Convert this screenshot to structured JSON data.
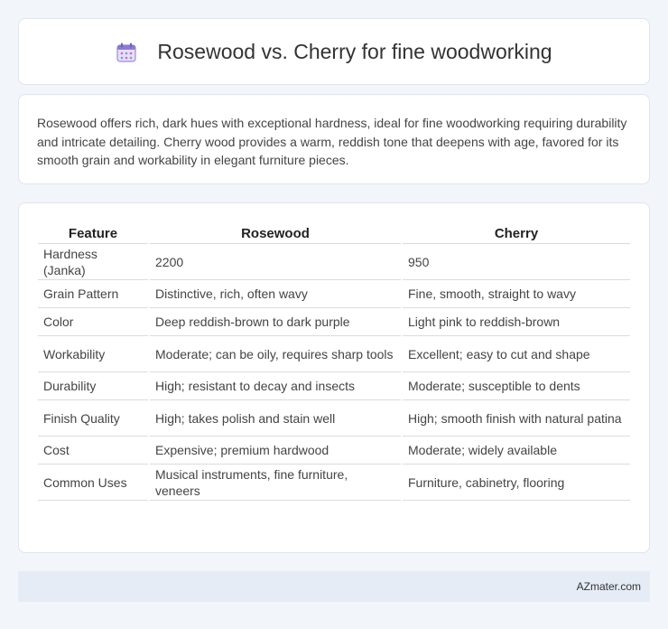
{
  "header": {
    "title": "Rosewood vs. Cherry for fine woodworking",
    "icon": "calendar-icon"
  },
  "description": "Rosewood offers rich, dark hues with exceptional hardness, ideal for fine woodworking requiring durability and intricate detailing. Cherry wood provides a warm, reddish tone that deepens with age, favored for its smooth grain and workability in elegant furniture pieces.",
  "table": {
    "columns": [
      "Feature",
      "Rosewood",
      "Cherry"
    ],
    "rows": [
      [
        "Hardness (Janka)",
        "2200",
        "950"
      ],
      [
        "Grain Pattern",
        "Distinctive, rich, often wavy",
        "Fine, smooth, straight to wavy"
      ],
      [
        "Color",
        "Deep reddish-brown to dark purple",
        "Light pink to reddish-brown"
      ],
      [
        "Workability",
        "Moderate; can be oily, requires sharp tools",
        "Excellent; easy to cut and shape"
      ],
      [
        "Durability",
        "High; resistant to decay and insects",
        "Moderate; susceptible to dents"
      ],
      [
        "Finish Quality",
        "High; takes polish and stain well",
        "High; smooth finish with natural patina"
      ],
      [
        "Cost",
        "Expensive; premium hardwood",
        "Moderate; widely available"
      ],
      [
        "Common Uses",
        "Musical instruments, fine furniture, veneers",
        "Furniture, cabinetry, flooring"
      ]
    ]
  },
  "footer": {
    "text": "AZmater.com"
  }
}
